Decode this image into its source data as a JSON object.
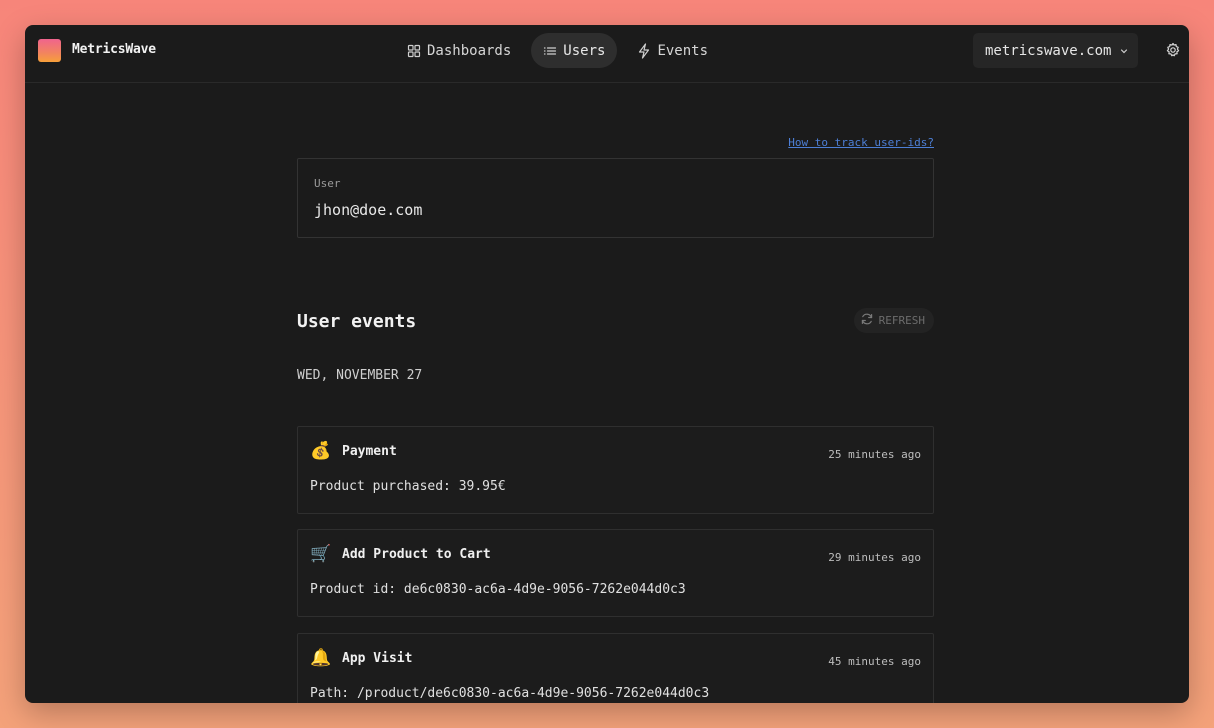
{
  "app": {
    "brand": "MetricsWave"
  },
  "nav": {
    "items": [
      {
        "label": "Dashboards",
        "icon": "grid-icon",
        "active": false
      },
      {
        "label": "Users",
        "icon": "list-icon",
        "active": true
      },
      {
        "label": "Events",
        "icon": "bolt-icon",
        "active": false
      }
    ]
  },
  "site_selector": {
    "value": "metricswave.com"
  },
  "help_link": {
    "label": "How to track user-ids?"
  },
  "user_field": {
    "label": "User",
    "value": "jhon@doe.com"
  },
  "events_section": {
    "title": "User events",
    "refresh_label": "REFRESH",
    "day_label": "WED, NOVEMBER 27",
    "events": [
      {
        "icon": "money-bag-icon",
        "emoji": "💰",
        "title": "Payment",
        "time": "25 minutes ago",
        "description": "Product purchased: 39.95€"
      },
      {
        "icon": "shopping-cart-icon",
        "emoji": "🛒",
        "title": "Add Product to Cart",
        "time": "29 minutes ago",
        "description": "Product id: de6c0830-ac6a-4d9e-9056-7262e044d0c3"
      },
      {
        "icon": "bell-icon",
        "emoji": "🔔",
        "title": "App Visit",
        "time": "45 minutes ago",
        "description": "Path: /product/de6c0830-ac6a-4d9e-9056-7262e044d0c3"
      }
    ]
  },
  "colors": {
    "accent_link": "#4d7fd6",
    "window_bg": "#1b1b1b",
    "active_nav_bg": "#2e2e2e"
  }
}
